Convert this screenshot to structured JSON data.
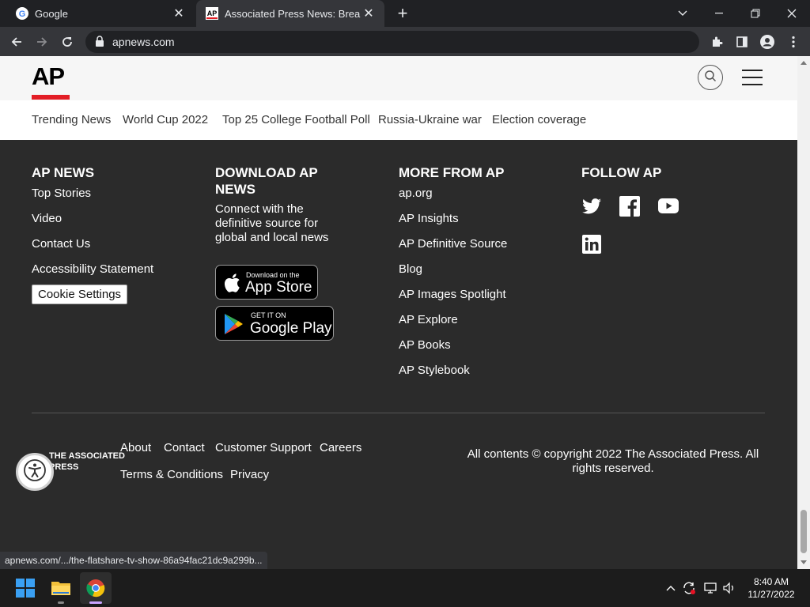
{
  "browser": {
    "tabs": [
      {
        "title": "Google",
        "close": "✕"
      },
      {
        "title": "Associated Press News: Breaking",
        "close": "✕"
      }
    ],
    "new_tab": "+",
    "url": "apnews.com",
    "status_url": "apnews.com/.../the-flatshare-tv-show-86a94fac21dc9a299b..."
  },
  "page": {
    "logo_text": "AP",
    "trending": [
      "Trending News",
      "World Cup 2022",
      "Top 25 College Football Poll",
      "Russia-Ukraine war",
      "Election coverage"
    ],
    "footer": {
      "ap_news": {
        "heading": "AP NEWS",
        "links": [
          "Top Stories",
          "Video",
          "Contact Us",
          "Accessibility Statement"
        ],
        "cookie_button": "Cookie Settings"
      },
      "download": {
        "heading_line1": "DOWNLOAD AP",
        "heading_line2": "NEWS",
        "description": "Connect with the definitive source for global and local news",
        "app_store_small": "Download on the",
        "app_store_big": "App Store",
        "google_play_small": "GET IT ON",
        "google_play_big": "Google Play"
      },
      "more": {
        "heading": "MORE FROM AP",
        "links": [
          "ap.org",
          "AP Insights",
          "AP Definitive Source",
          "Blog",
          "AP Images Spotlight",
          "AP Explore",
          "AP Books",
          "AP Stylebook"
        ]
      },
      "follow": {
        "heading": "FOLLOW AP",
        "icons": [
          "twitter-icon",
          "facebook-icon",
          "youtube-icon",
          "linkedin-icon"
        ]
      },
      "bottom_links": [
        "About",
        "Contact",
        "Customer Support",
        "Careers",
        "Terms & Conditions",
        "Privacy"
      ],
      "copyright": "All contents © copyright 2022 The Associated Press. All rights reserved.",
      "logo_line1": "THE ASSOCIATED",
      "logo_line2": "PRESS"
    }
  },
  "taskbar": {
    "time": "8:40 AM",
    "date": "11/27/2022"
  },
  "colors": {
    "ap_red": "#e31e26",
    "footer_bg": "#2b2b2b",
    "chrome_bg": "#202124",
    "toolbar_bg": "#35363a"
  }
}
